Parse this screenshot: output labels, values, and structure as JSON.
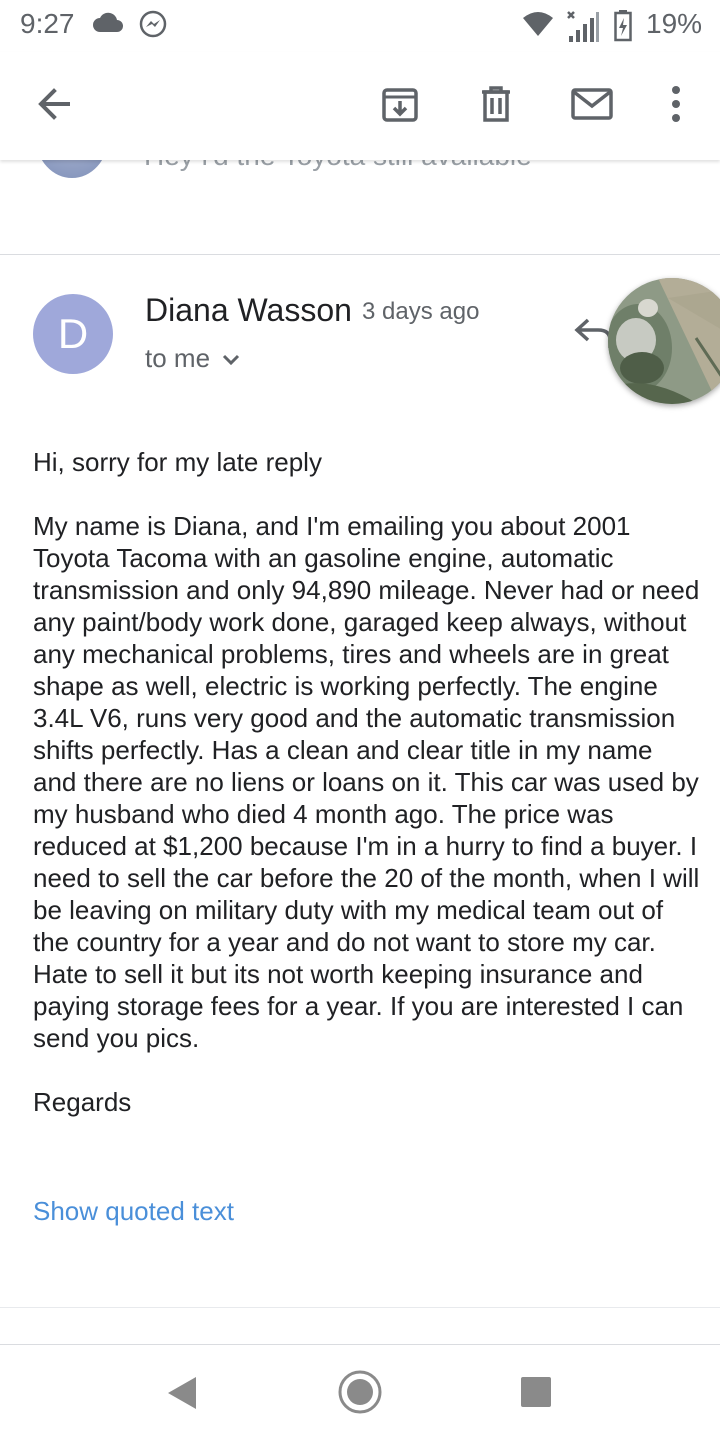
{
  "status_bar": {
    "time": "9:27",
    "battery_percent": "19%"
  },
  "previous_message": {
    "snippet": "Hey i'd the Toyota still available"
  },
  "message": {
    "avatar_letter": "D",
    "sender": "Diana Wasson",
    "time": "3 days ago",
    "recipient": "to me",
    "paragraphs": [
      "Hi, sorry for my late reply",
      "My name is Diana, and I'm emailing you about  2001 Toyota Tacoma with an gasoline engine, automatic transmission and only 94,890 mileage. Never had or need any paint/body work done, garaged keep always, without any mechanical problems, tires and wheels are in great shape as well, electric is working perfectly. The engine 3.4L V6, runs very good and the automatic transmission shifts perfectly. Has a clean and clear title in my name and there are no liens or loans on it. This car was used by my husband who died 4 month ago. The price was reduced at $1,200 because I'm in a hurry to find a buyer. I need to sell the car before the 20 of the month, when I will be leaving on military duty with my medical team out of the country for a year and do not want to store my car. Hate to sell it but its not worth keeping insurance and paying storage fees for a year. If you are interested I can send you pics.",
      "Regards"
    ],
    "show_quoted_text": "Show quoted text"
  },
  "colors": {
    "avatar_bg": "#9fa8da",
    "link": "#4a8fd9",
    "icon_gray": "#5f6368"
  }
}
